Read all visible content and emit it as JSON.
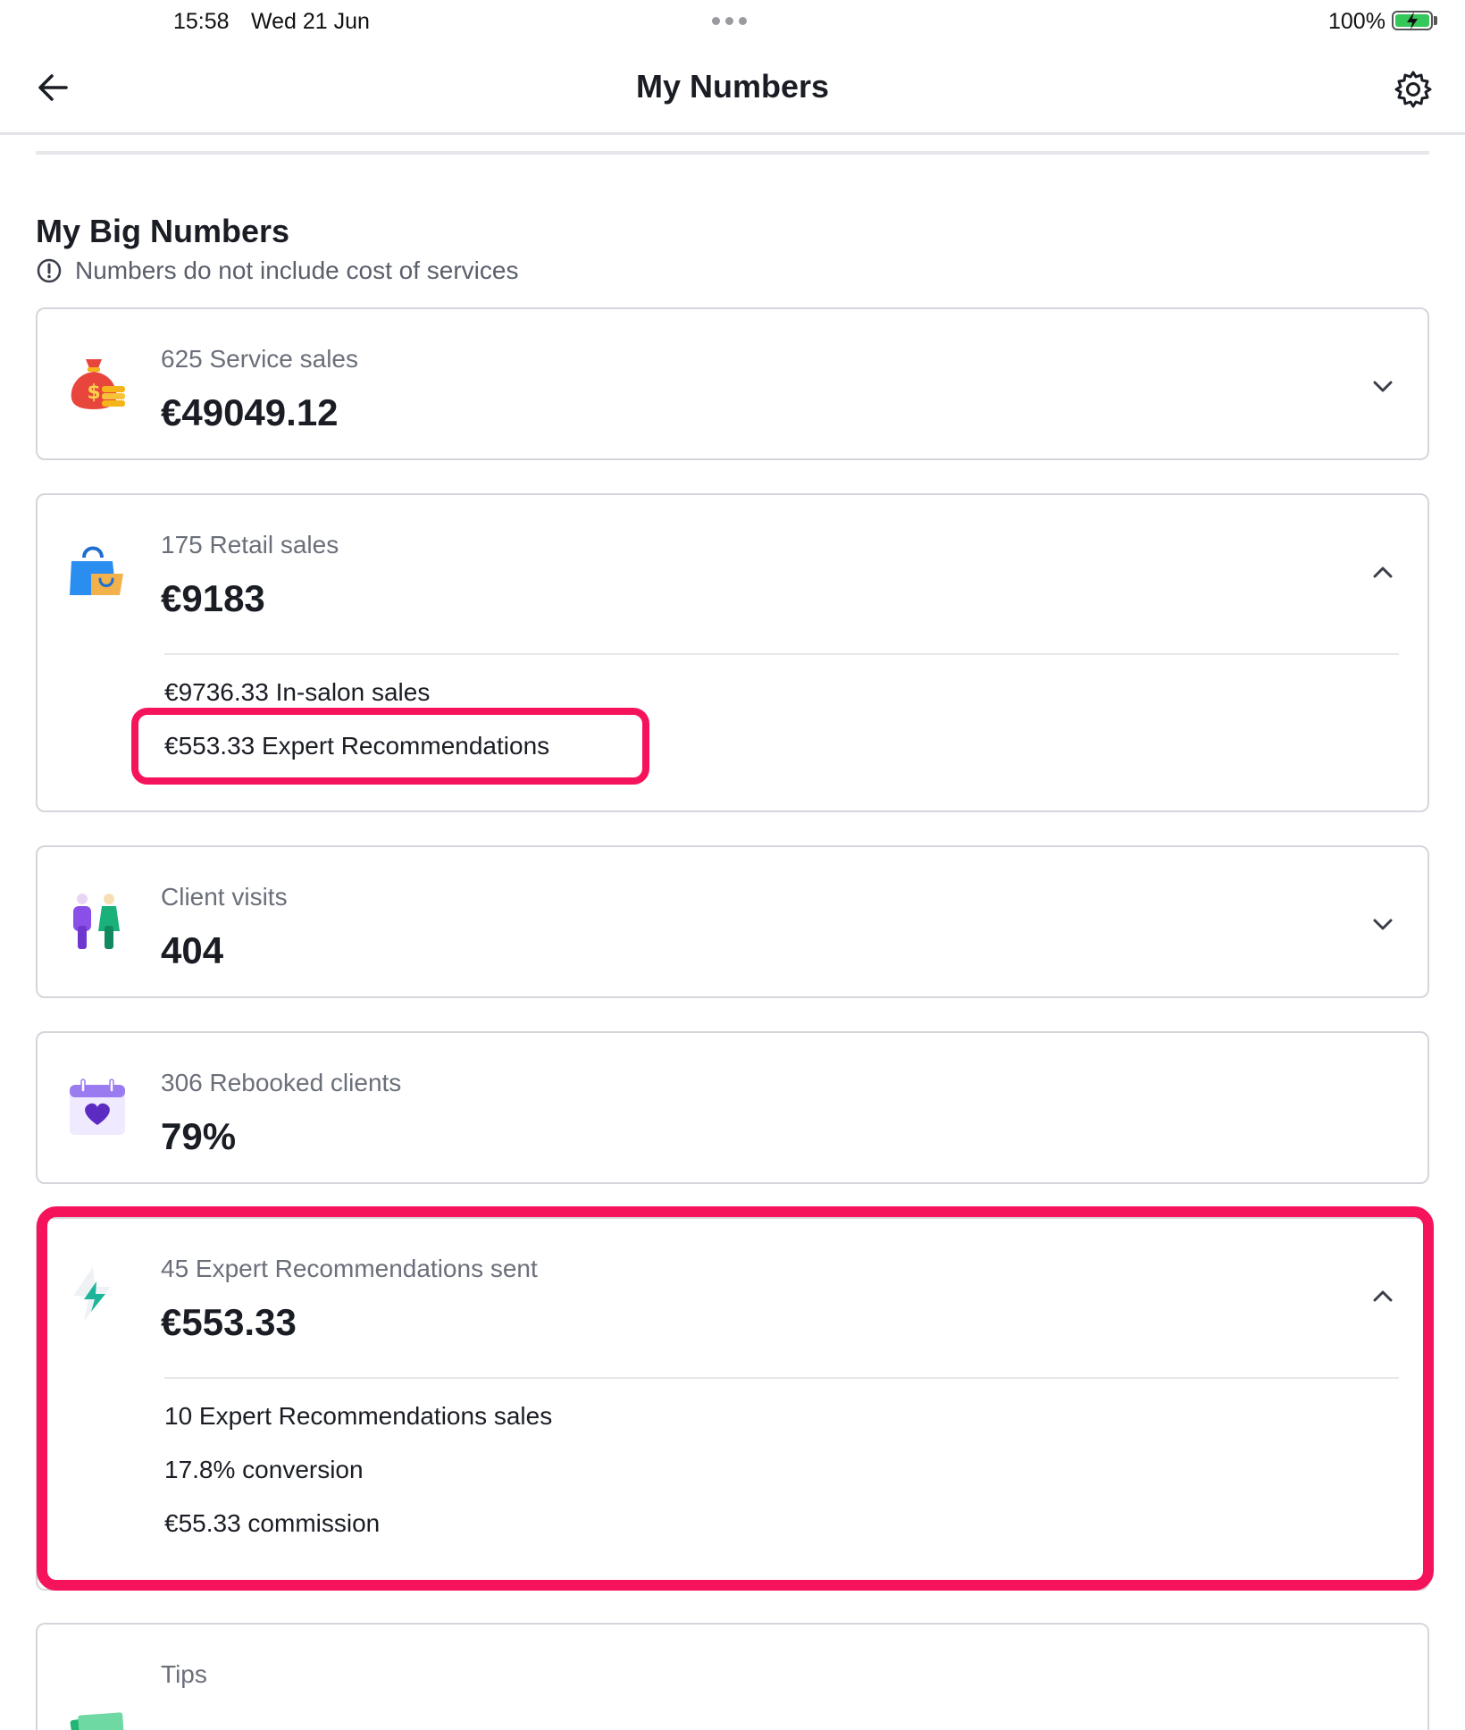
{
  "status_bar": {
    "time": "15:58",
    "date": "Wed 21 Jun",
    "battery": "100%"
  },
  "header": {
    "title": "My Numbers",
    "back_icon": "arrow-left-icon",
    "settings_icon": "gear-icon"
  },
  "section": {
    "title": "My Big Numbers",
    "info": "Numbers do not include cost of services"
  },
  "cards": [
    {
      "label": "625 Service sales",
      "value": "€49049.12",
      "icon": "money-bag-icon",
      "expanded": false
    },
    {
      "label": "175 Retail sales",
      "value": "€9183",
      "icon": "shopping-bag-icon",
      "expanded": true,
      "details": [
        "€9736.33 In-salon sales",
        "€553.33 Expert Recommendations"
      ]
    },
    {
      "label": "Client visits",
      "value": "404",
      "icon": "people-icon",
      "expanded": false
    },
    {
      "label": "306 Rebooked clients",
      "value": "79%",
      "icon": "calendar-heart-icon",
      "expanded": false
    },
    {
      "label": "45 Expert Recommendations sent",
      "value": "€553.33",
      "icon": "lightning-icon",
      "expanded": true,
      "details": [
        "10 Expert Recommendations sales",
        "17.8% conversion",
        "€55.33 commission"
      ]
    },
    {
      "label": "Tips",
      "icon": "cash-icon",
      "expanded": false
    }
  ],
  "colors": {
    "highlight": "#f5145c",
    "text": "#1a1d24",
    "muted": "#6b6f7a",
    "border": "#d4d6dc"
  }
}
